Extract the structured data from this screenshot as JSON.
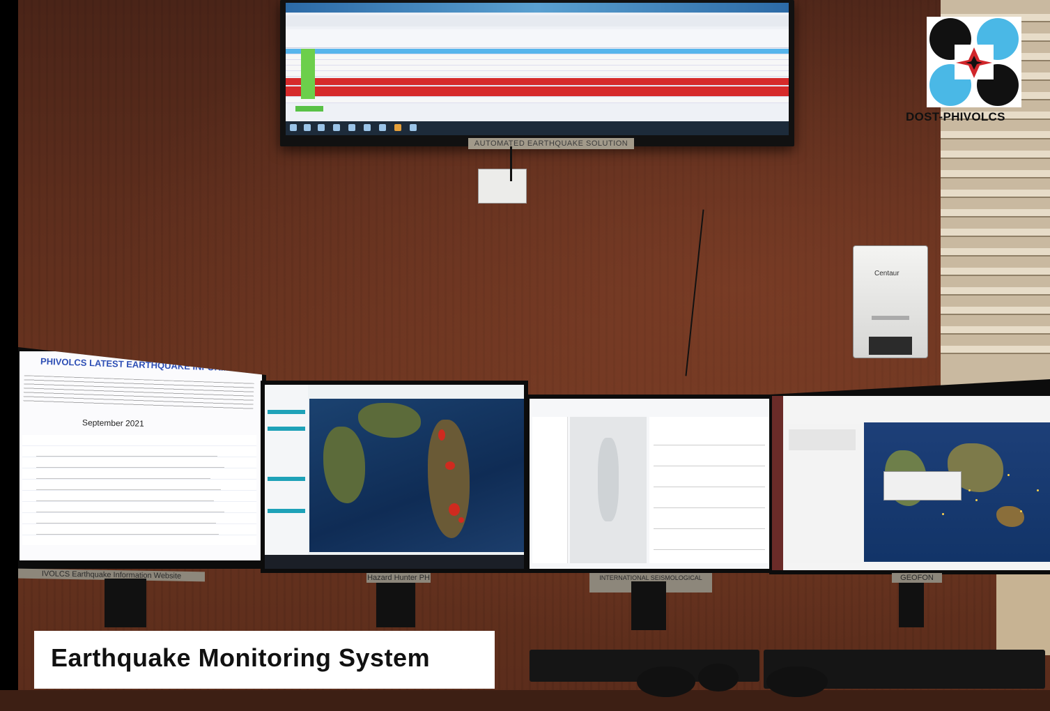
{
  "caption": {
    "text": "Earthquake Monitoring System"
  },
  "logo": {
    "text": "DOST-PHIVOLCS"
  },
  "wall_display": {
    "label": "AUTOMATED EARTHQUAKE SOLUTION"
  },
  "monitors": [
    {
      "label": "IVOLCS Earthquake Information Website",
      "title": "PHIVOLCS LATEST EARTHQUAKE INFORMATION",
      "month": "September 2021"
    },
    {
      "label": "Hazard Hunter PH"
    },
    {
      "label": "INTERNATIONAL SEISMOLOGICAL CENTER"
    },
    {
      "label": "GEOFON"
    }
  ],
  "device": {
    "label": "Centaur"
  },
  "colors": {
    "tv_alert_row": "#d62a2a",
    "tv_selected_row": "#57b5ec",
    "map_hotspot": "#d02a1f"
  }
}
